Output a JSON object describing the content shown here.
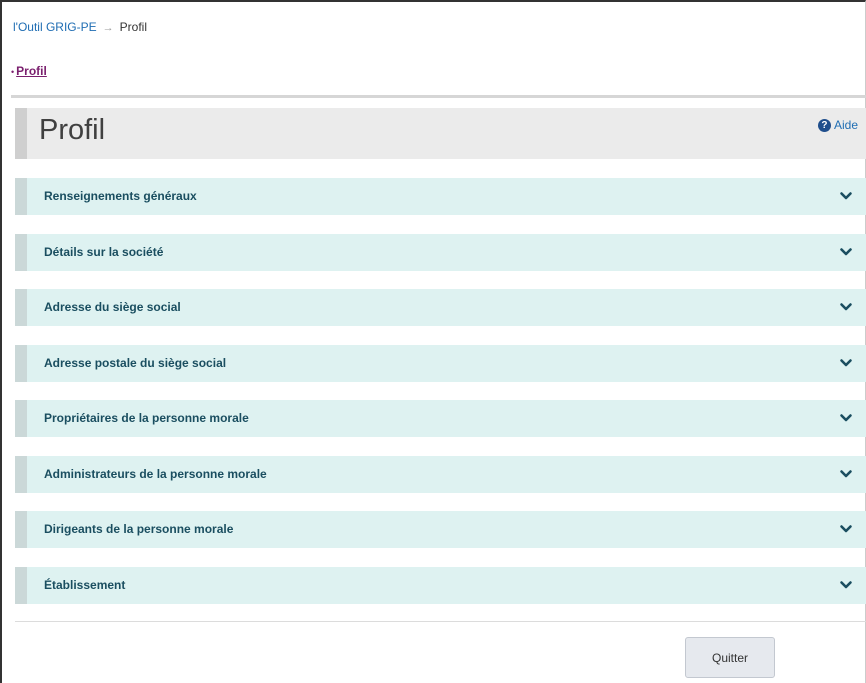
{
  "breadcrumb": {
    "home_label": "l'Outil GRIG-PE",
    "separator": "→",
    "current_label": "Profil"
  },
  "subnav": {
    "bullet": "•",
    "active_label": "Profil"
  },
  "header": {
    "title": "Profil",
    "help_icon_glyph": "?",
    "help_label": "Aide"
  },
  "sections": [
    {
      "label": "Renseignements généraux",
      "expanded": false
    },
    {
      "label": "Détails sur la société",
      "expanded": false
    },
    {
      "label": "Adresse du siège social",
      "expanded": false
    },
    {
      "label": "Adresse postale du siège social",
      "expanded": false
    },
    {
      "label": "Propriétaires de la personne morale",
      "expanded": false
    },
    {
      "label": "Administrateurs de la personne morale",
      "expanded": false
    },
    {
      "label": "Dirigeants de la personne morale",
      "expanded": false
    },
    {
      "label": "Établissement",
      "expanded": false
    }
  ],
  "actions": {
    "quit_label": "Quitter"
  },
  "icons": {
    "help": "question-circle-icon",
    "section_toggle": "chevron-down-icon"
  },
  "colors": {
    "link": "#1f6db3",
    "active_nav": "#7a1f6e",
    "accordion_bg": "#def2f1",
    "accordion_text": "#1a4e60",
    "help_icon_bg": "#1f4e8c"
  }
}
